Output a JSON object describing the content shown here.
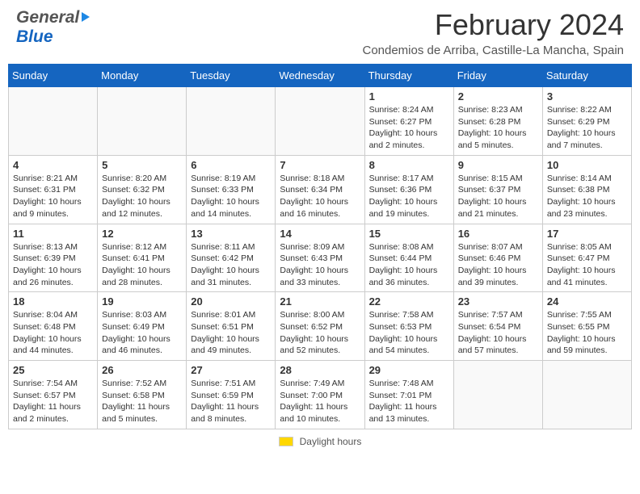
{
  "header": {
    "logo_general": "General",
    "logo_blue": "Blue",
    "main_title": "February 2024",
    "subtitle": "Condemios de Arriba, Castille-La Mancha, Spain"
  },
  "calendar": {
    "days_of_week": [
      "Sunday",
      "Monday",
      "Tuesday",
      "Wednesday",
      "Thursday",
      "Friday",
      "Saturday"
    ],
    "weeks": [
      [
        {
          "day": "",
          "info": ""
        },
        {
          "day": "",
          "info": ""
        },
        {
          "day": "",
          "info": ""
        },
        {
          "day": "",
          "info": ""
        },
        {
          "day": "1",
          "info": "Sunrise: 8:24 AM\nSunset: 6:27 PM\nDaylight: 10 hours\nand 2 minutes."
        },
        {
          "day": "2",
          "info": "Sunrise: 8:23 AM\nSunset: 6:28 PM\nDaylight: 10 hours\nand 5 minutes."
        },
        {
          "day": "3",
          "info": "Sunrise: 8:22 AM\nSunset: 6:29 PM\nDaylight: 10 hours\nand 7 minutes."
        }
      ],
      [
        {
          "day": "4",
          "info": "Sunrise: 8:21 AM\nSunset: 6:31 PM\nDaylight: 10 hours\nand 9 minutes."
        },
        {
          "day": "5",
          "info": "Sunrise: 8:20 AM\nSunset: 6:32 PM\nDaylight: 10 hours\nand 12 minutes."
        },
        {
          "day": "6",
          "info": "Sunrise: 8:19 AM\nSunset: 6:33 PM\nDaylight: 10 hours\nand 14 minutes."
        },
        {
          "day": "7",
          "info": "Sunrise: 8:18 AM\nSunset: 6:34 PM\nDaylight: 10 hours\nand 16 minutes."
        },
        {
          "day": "8",
          "info": "Sunrise: 8:17 AM\nSunset: 6:36 PM\nDaylight: 10 hours\nand 19 minutes."
        },
        {
          "day": "9",
          "info": "Sunrise: 8:15 AM\nSunset: 6:37 PM\nDaylight: 10 hours\nand 21 minutes."
        },
        {
          "day": "10",
          "info": "Sunrise: 8:14 AM\nSunset: 6:38 PM\nDaylight: 10 hours\nand 23 minutes."
        }
      ],
      [
        {
          "day": "11",
          "info": "Sunrise: 8:13 AM\nSunset: 6:39 PM\nDaylight: 10 hours\nand 26 minutes."
        },
        {
          "day": "12",
          "info": "Sunrise: 8:12 AM\nSunset: 6:41 PM\nDaylight: 10 hours\nand 28 minutes."
        },
        {
          "day": "13",
          "info": "Sunrise: 8:11 AM\nSunset: 6:42 PM\nDaylight: 10 hours\nand 31 minutes."
        },
        {
          "day": "14",
          "info": "Sunrise: 8:09 AM\nSunset: 6:43 PM\nDaylight: 10 hours\nand 33 minutes."
        },
        {
          "day": "15",
          "info": "Sunrise: 8:08 AM\nSunset: 6:44 PM\nDaylight: 10 hours\nand 36 minutes."
        },
        {
          "day": "16",
          "info": "Sunrise: 8:07 AM\nSunset: 6:46 PM\nDaylight: 10 hours\nand 39 minutes."
        },
        {
          "day": "17",
          "info": "Sunrise: 8:05 AM\nSunset: 6:47 PM\nDaylight: 10 hours\nand 41 minutes."
        }
      ],
      [
        {
          "day": "18",
          "info": "Sunrise: 8:04 AM\nSunset: 6:48 PM\nDaylight: 10 hours\nand 44 minutes."
        },
        {
          "day": "19",
          "info": "Sunrise: 8:03 AM\nSunset: 6:49 PM\nDaylight: 10 hours\nand 46 minutes."
        },
        {
          "day": "20",
          "info": "Sunrise: 8:01 AM\nSunset: 6:51 PM\nDaylight: 10 hours\nand 49 minutes."
        },
        {
          "day": "21",
          "info": "Sunrise: 8:00 AM\nSunset: 6:52 PM\nDaylight: 10 hours\nand 52 minutes."
        },
        {
          "day": "22",
          "info": "Sunrise: 7:58 AM\nSunset: 6:53 PM\nDaylight: 10 hours\nand 54 minutes."
        },
        {
          "day": "23",
          "info": "Sunrise: 7:57 AM\nSunset: 6:54 PM\nDaylight: 10 hours\nand 57 minutes."
        },
        {
          "day": "24",
          "info": "Sunrise: 7:55 AM\nSunset: 6:55 PM\nDaylight: 10 hours\nand 59 minutes."
        }
      ],
      [
        {
          "day": "25",
          "info": "Sunrise: 7:54 AM\nSunset: 6:57 PM\nDaylight: 11 hours\nand 2 minutes."
        },
        {
          "day": "26",
          "info": "Sunrise: 7:52 AM\nSunset: 6:58 PM\nDaylight: 11 hours\nand 5 minutes."
        },
        {
          "day": "27",
          "info": "Sunrise: 7:51 AM\nSunset: 6:59 PM\nDaylight: 11 hours\nand 8 minutes."
        },
        {
          "day": "28",
          "info": "Sunrise: 7:49 AM\nSunset: 7:00 PM\nDaylight: 11 hours\nand 10 minutes."
        },
        {
          "day": "29",
          "info": "Sunrise: 7:48 AM\nSunset: 7:01 PM\nDaylight: 11 hours\nand 13 minutes."
        },
        {
          "day": "",
          "info": ""
        },
        {
          "day": "",
          "info": ""
        }
      ]
    ]
  },
  "legend": {
    "box_label": "Daylight hours"
  }
}
